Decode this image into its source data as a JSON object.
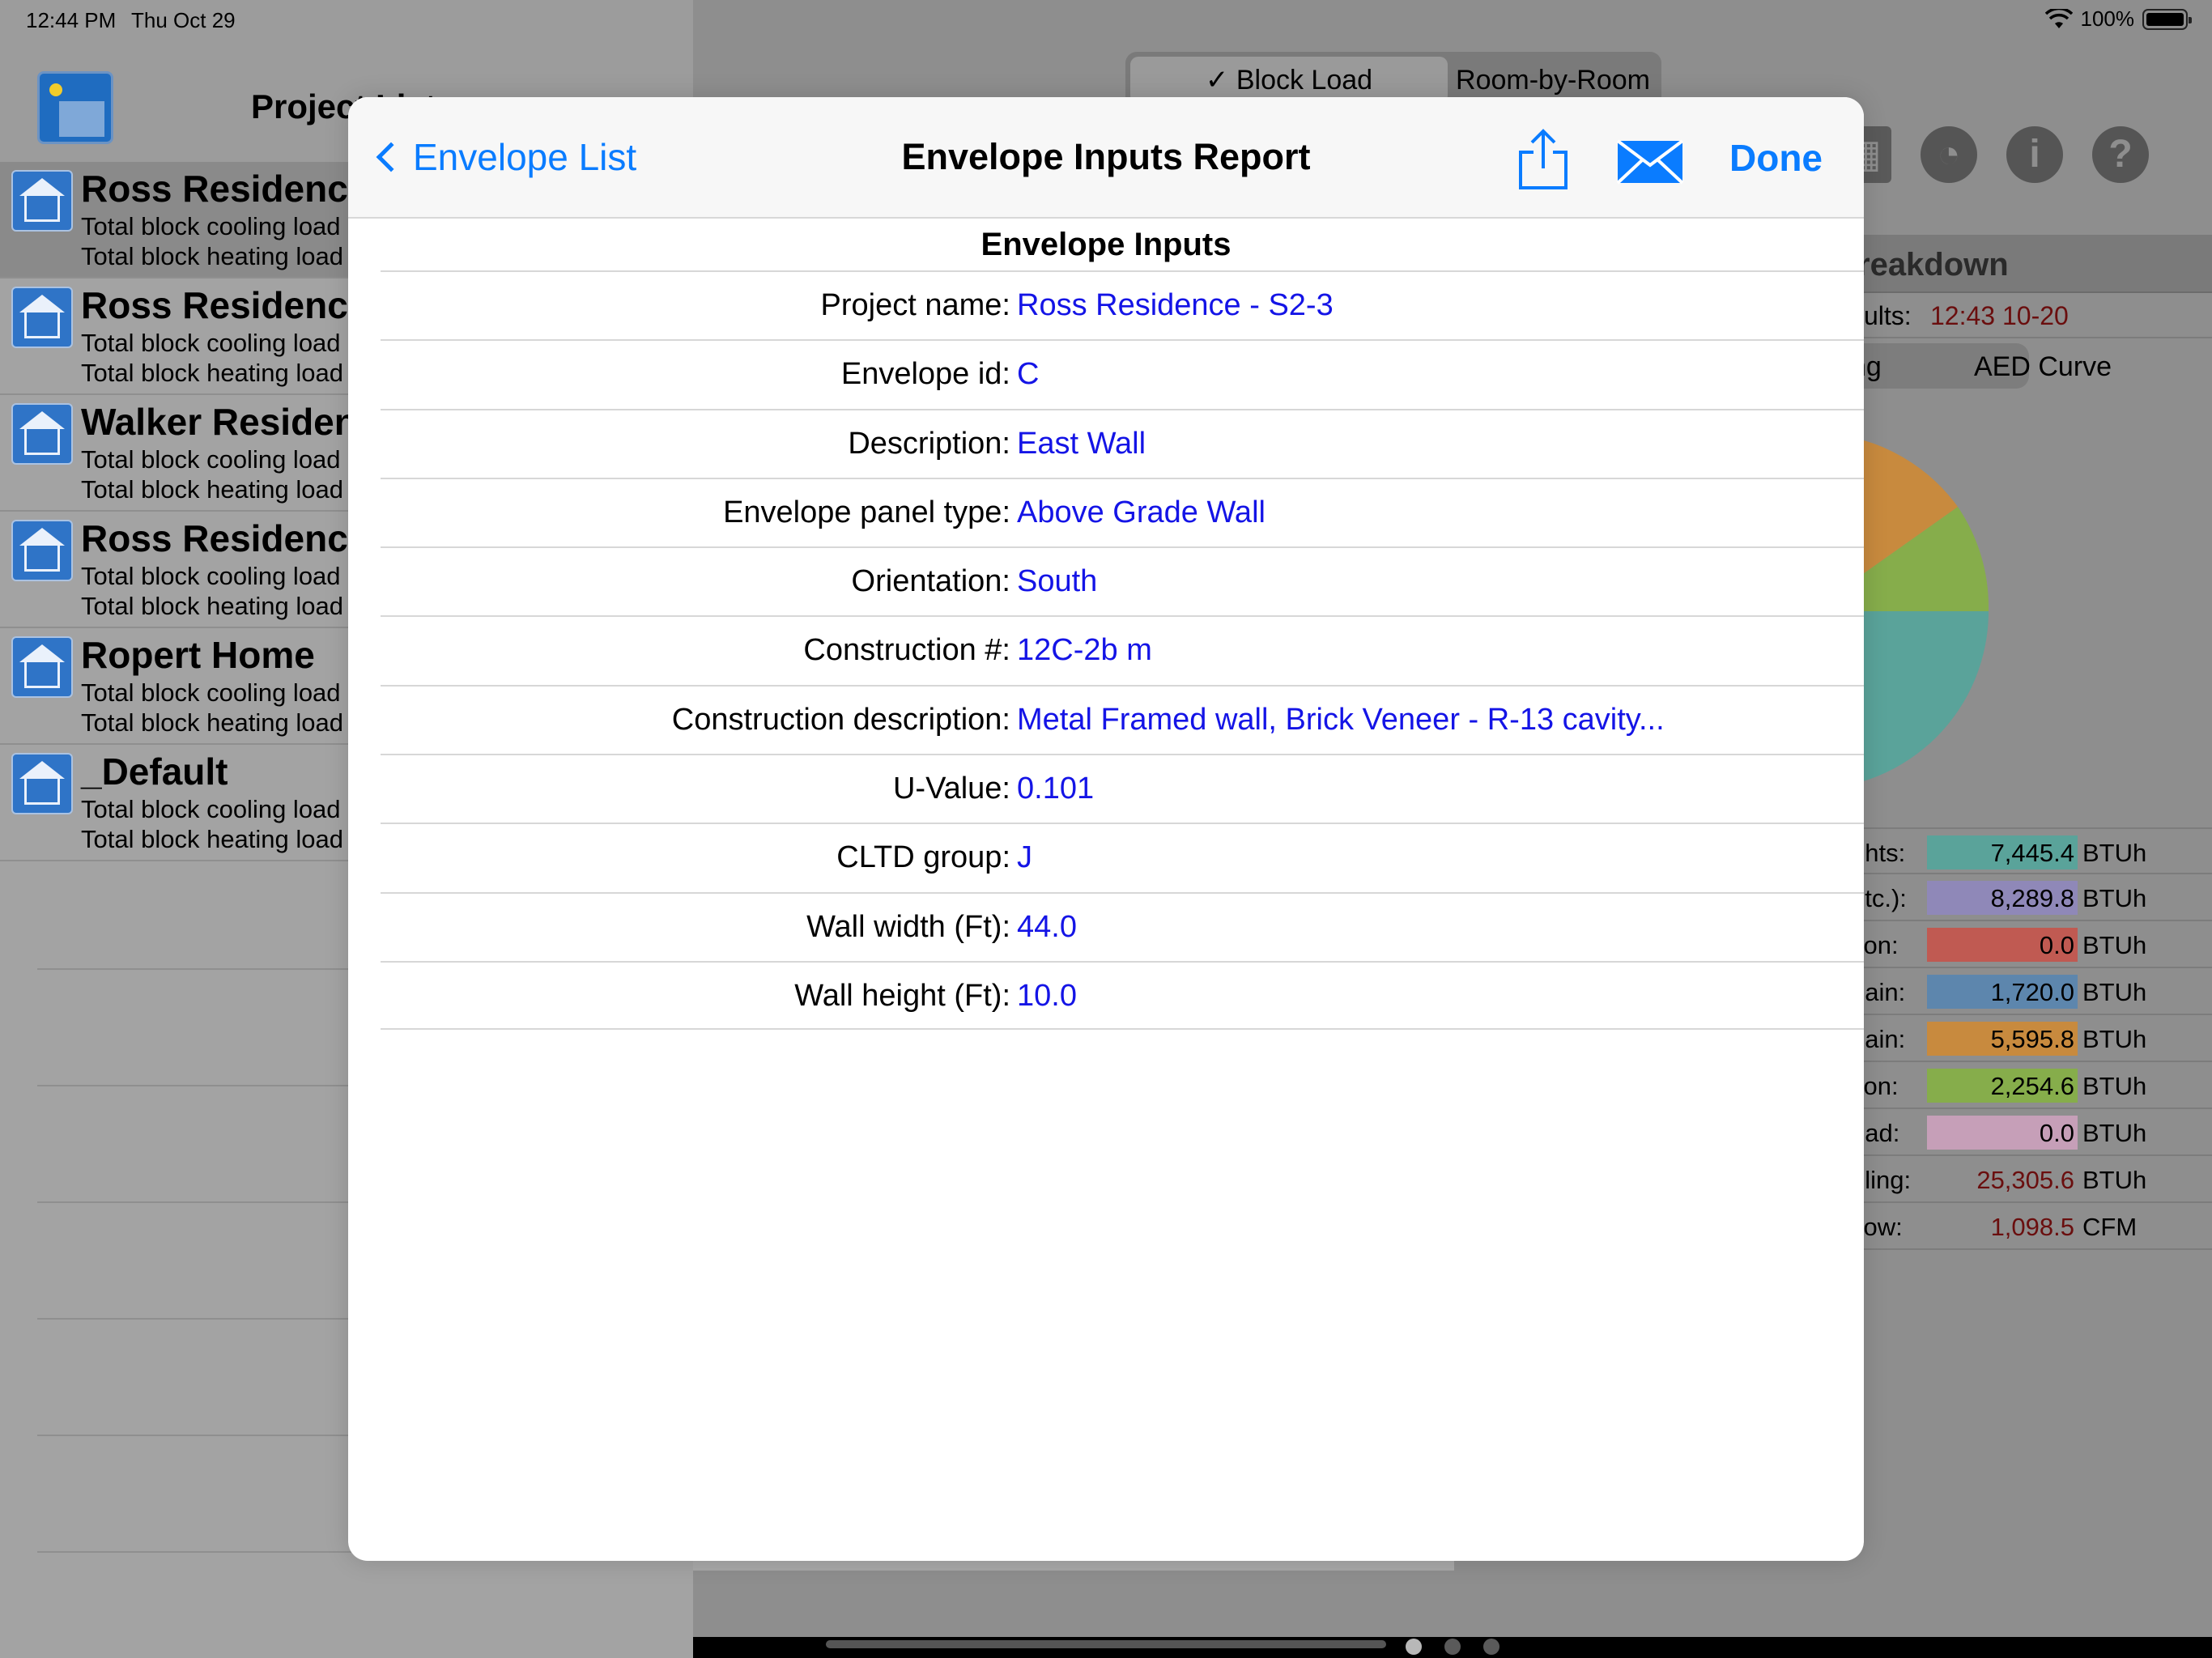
{
  "status_bar": {
    "time": "12:44 PM",
    "date": "Thu Oct 29",
    "battery": "100%"
  },
  "master": {
    "title": "Project List",
    "projects": [
      {
        "name": "Ross Residence",
        "line1": "Total block cooling load",
        "line2": "Total block heating load",
        "selected": true
      },
      {
        "name": "Ross Residence",
        "line1": "Total block cooling load",
        "line2": "Total block heating load",
        "selected": false
      },
      {
        "name": "Walker Residence",
        "line1": "Total block cooling load",
        "line2": "Total block heating load",
        "selected": false
      },
      {
        "name": "Ross Residence",
        "line1": "Total block cooling load",
        "line2": "Total block heating load",
        "selected": false
      },
      {
        "name": "Ropert Home",
        "line1": "Total block cooling load",
        "line2": "Total block heating load",
        "selected": false
      },
      {
        "name": "_Default",
        "line1": "Total block cooling load",
        "line2": "Total block heating load",
        "selected": false
      }
    ]
  },
  "detail": {
    "segments": {
      "block_load": "✓ Block Load",
      "room_by_room": "Room-by-Room"
    },
    "breakdown_title": "reakdown",
    "results_label": "sults:",
    "results_time": "12:43 10-20",
    "chart_segments": {
      "left": "ng",
      "right": "AED Curve"
    },
    "legend": [
      {
        "label": "ghts:",
        "value": "7,445.4",
        "unit": "BTUh",
        "color": "#5aa39a"
      },
      {
        "label": "etc.):",
        "value": "8,289.8",
        "unit": "BTUh",
        "color": "#8f88b8"
      },
      {
        "label": "tion:",
        "value": "0.0",
        "unit": "BTUh",
        "color": "#c05a52"
      },
      {
        "label": "gain:",
        "value": "1,720.0",
        "unit": "BTUh",
        "color": "#5d86ad"
      },
      {
        "label": "gain:",
        "value": "5,595.8",
        "unit": "BTUh",
        "color": "#c88a3e"
      },
      {
        "label": "tion:",
        "value": "2,254.6",
        "unit": "BTUh",
        "color": "#86ad4b"
      },
      {
        "label": "oad:",
        "value": "0.0",
        "unit": "BTUh",
        "color": "#c69fb8"
      },
      {
        "label": "oling:",
        "value": "25,305.6",
        "unit": "BTUh",
        "color": ""
      },
      {
        "label": "flow:",
        "value": "1,098.5",
        "unit": "CFM",
        "color": ""
      }
    ]
  },
  "modal": {
    "back_label": "Envelope List",
    "title": "Envelope Inputs Report",
    "done_label": "Done",
    "section_title": "Envelope Inputs",
    "rows": [
      {
        "label": "Project name:",
        "value": "Ross Residence - S2-3"
      },
      {
        "label": "Envelope id:",
        "value": "C"
      },
      {
        "label": "Description:",
        "value": "East Wall"
      },
      {
        "label": "Envelope panel type:",
        "value": "Above Grade Wall"
      },
      {
        "label": "Orientation:",
        "value": "South"
      },
      {
        "label": "Construction #:",
        "value": "12C-2b m"
      },
      {
        "label": "Construction description:",
        "value": "Metal Framed wall, Brick Veneer - R-13 cavity..."
      },
      {
        "label": "U-Value:",
        "value": "0.101"
      },
      {
        "label": "CLTD group:",
        "value": "J"
      },
      {
        "label": "Wall width (Ft):",
        "value": "44.0"
      },
      {
        "label": "Wall height (Ft):",
        "value": "10.0"
      }
    ]
  },
  "colors": {
    "accent": "#0a7cff",
    "value_text": "#1414e6",
    "result_text": "#6a0e0e"
  }
}
